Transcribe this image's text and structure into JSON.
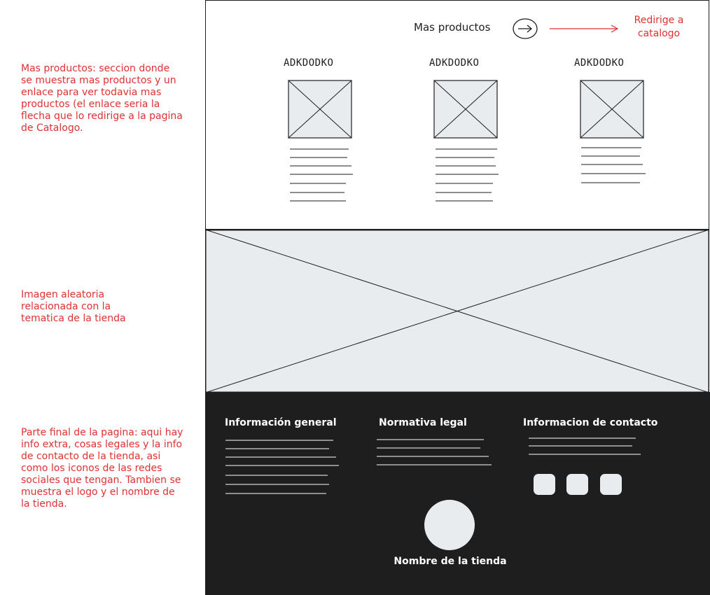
{
  "annotations": {
    "products_note": "Mas productos: seccion donde se muestra mas productos y un enlace para ver todavia mas productos (el enlace seria la flecha que lo redirige a la pagina de Catalogo.",
    "image_note": "Imagen aleatoria relacionada con la tematica de la tienda",
    "footer_note": "Parte final de la pagina: aqui hay info extra, cosas legales y la info de contacto de la tienda, asi como los iconos de las redes sociales que tengan. Tambien se muestra el logo y el nombre de la tienda.",
    "redirect_note_line1": "Redirige a",
    "redirect_note_line2": "catalogo"
  },
  "products_section": {
    "more_label": "Mas productos",
    "arrow_icon": "arrow-right-icon",
    "products": [
      {
        "title": "ADKDODKO"
      },
      {
        "title": "ADKDODKO"
      },
      {
        "title": "ADKDODKO"
      }
    ]
  },
  "footer": {
    "headings": [
      "Información general",
      "Normativa legal",
      "Informacion de contacto"
    ],
    "social_icons": [
      "social-icon",
      "social-icon",
      "social-icon"
    ],
    "store_name": "Nombre de la tienda"
  },
  "colors": {
    "annotation": "#e03131",
    "stroke": "#1e1e1e",
    "placeholder_fill": "#e9ecef",
    "footer_bg": "#1e1e1e"
  }
}
